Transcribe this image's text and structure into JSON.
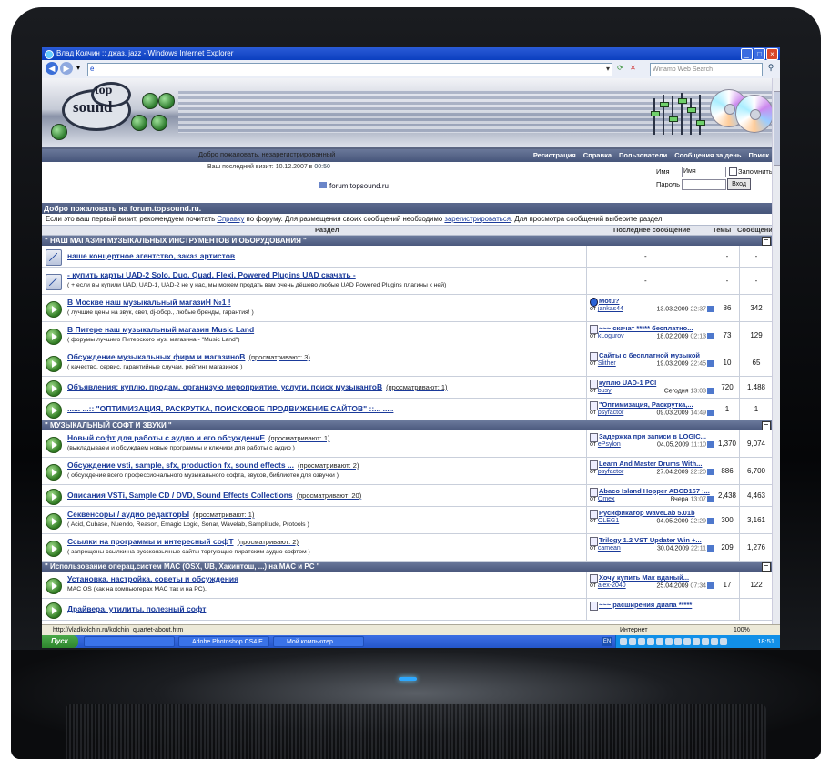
{
  "window": {
    "title": "Влад Колчин :: джаз, jazz - Windows Internet Explorer",
    "address": "e",
    "search_placeholder": "Winamp Web Search"
  },
  "logo": {
    "top": "top",
    "sound": "sound"
  },
  "header": {
    "welcome": "Добро пожаловать, незарегистрированный",
    "last_visit_label": "Ваш последний визит: 10.12.2007 в",
    "last_visit_time": "00:50",
    "forum_name": "forum.topsound.ru",
    "nav": [
      "Регистрация",
      "Справка",
      "Пользователи",
      "Сообщения за день",
      "Поиск"
    ]
  },
  "login": {
    "name_label": "Имя",
    "name_value": "Имя",
    "remember_label": "Запомнить?",
    "password_label": "Пароль",
    "submit": "Вход"
  },
  "welcome_bar": "Добро пожаловать на forum.topsound.ru.",
  "intro": {
    "part1": "Если это ваш первый визит, рекомендуем почитать ",
    "link1": "Справку",
    "part2": " по форуму. Для размещения своих сообщений необходимо ",
    "link2": "зарегистрироваться",
    "part3": ". Для просмотра сообщений выберите раздел."
  },
  "table_head": {
    "section": "Раздел",
    "last_post": "Последнее сообщение",
    "topics": "Темы",
    "posts": "Сообщения"
  },
  "categories": [
    {
      "title": "\" НАШ МАГАЗИН МУЗЫКАЛЬНЫХ ИНСТРУМЕНТОВ И ОБОРУДОВАНИЯ \"",
      "forums": [
        {
          "kind": "link",
          "title": "наше концертное агентство, заказ артистов",
          "viewing": "",
          "desc": "",
          "last_title": "",
          "by": "",
          "date": "",
          "time": "",
          "topics": "-",
          "posts": "-",
          "lp_dash": "-"
        },
        {
          "kind": "link",
          "title": "- купить карты UAD-2 Solo, Duo, Quad, Flexi, Powered Plugins UAD скачать -",
          "viewing": "",
          "desc": "( + если вы купили UAD, UAD-1, UAD-2 не у нас, мы можем продать вам очень дёшево любые UAD Powered Plugins плагины к ней)",
          "last_title": "",
          "by": "",
          "date": "",
          "time": "",
          "topics": "-",
          "posts": "-",
          "lp_dash": "-"
        },
        {
          "kind": "forum",
          "title": "В Москве наш музыкальный магазиН №1 !",
          "viewing": "",
          "desc": "( лучшие цены на звук, свет, dj-обор., любые бренды, гарантия! )",
          "last_title": "Мotu?",
          "by": "jankas44",
          "date": "13.03.2009",
          "time": "22:37",
          "topics": "86",
          "posts": "342",
          "lp_dash": "",
          "qicon": true
        },
        {
          "kind": "forum",
          "title": "В Питере наш музыкальный магазин Music Land",
          "viewing": "",
          "desc": "( форумы лучшего Питерского муз. магазина - \"Music Land\")",
          "last_title": "~~~ скачат ***** бесплатно...",
          "by": "kLogurov",
          "date": "18.02.2009",
          "time": "02:13",
          "topics": "73",
          "posts": "129",
          "lp_dash": ""
        },
        {
          "kind": "forum",
          "title": "Обсуждение музыкальных фирм и магазиноВ",
          "viewing": "(просматривают: 3)",
          "desc": "( качество, сервис, гарантийные случаи, рейтинг магазинов )",
          "last_title": "Сайты с бесплатной музыкой",
          "by": "Slither",
          "date": "19.03.2009",
          "time": "22:45",
          "topics": "10",
          "posts": "65",
          "lp_dash": ""
        },
        {
          "kind": "forum",
          "title": "Объявления: куплю, продам, организую мероприятие, услуги, поиск музыкантоВ",
          "viewing": "(просматривают: 1)",
          "desc": "",
          "last_title": "куплю UAD-1 PCI",
          "by": "busy",
          "date": "Сегодня",
          "time": "13:03",
          "topics": "720",
          "posts": "1,488",
          "lp_dash": ""
        },
        {
          "kind": "forum",
          "title": "...... ...:: \"ОПТИМИЗАЦИЯ, РАСКРУТКА, ПОИСКОВОЕ ПРОДВИЖЕНИЕ САЙТОВ\" ::... .....",
          "viewing": "",
          "desc": "",
          "last_title": "\"Оптимизация, Раскрутка,...",
          "by": "psyfactor",
          "date": "09.03.2009",
          "time": "14:49",
          "topics": "1",
          "posts": "1",
          "lp_dash": ""
        }
      ]
    },
    {
      "title": "\" МУЗЫКАЛЬНЫЙ СОФТ И ЗВУКИ \"",
      "forums": [
        {
          "kind": "forum",
          "title": "Новый софт для работы с аудио и его обсуждениЕ",
          "viewing": "(просматривают: 1)",
          "desc": "(выкладываем и обсуждаем новые программы и ключики для работы с аудио )",
          "last_title": "Задержка при записи в LOGIC...",
          "by": "ePsylon",
          "date": "04.05.2009",
          "time": "11:10",
          "topics": "1,370",
          "posts": "9,074",
          "lp_dash": ""
        },
        {
          "kind": "forum",
          "title": "Обсуждение vsti, sample, sfx, production fx, sound effects ...",
          "viewing": "(просматривают: 2)",
          "desc": "( обсуждение всего профессионального музыкального софта, звуков, библиотек для озвучки )",
          "last_title": "Learn And Master Drums With...",
          "by": "psyfactor",
          "date": "27.04.2009",
          "time": "22:20",
          "topics": "886",
          "posts": "6,700",
          "lp_dash": ""
        },
        {
          "kind": "forum",
          "title": "Описания VSTi, Sample CD / DVD, Sound Effects Collections",
          "viewing": "(просматривают: 20)",
          "desc": "",
          "last_title": "Abaco Island Hopper ABCD167 :...",
          "by": "Omex",
          "date": "Вчера",
          "time": "13:07",
          "topics": "2,438",
          "posts": "4,463",
          "lp_dash": ""
        },
        {
          "kind": "forum",
          "title": "Секвенсоры / аудио редакторЫ",
          "viewing": "(просматривают: 1)",
          "desc": "( Acid, Cubase, Nuendo, Reason, Emagic Logic, Sonar, Wavelab, Samplitude, Protools )",
          "last_title": "Русификатор WaveLab 5.01b",
          "by": "OLEG1",
          "date": "04.05.2009",
          "time": "22:29",
          "topics": "300",
          "posts": "3,161",
          "lp_dash": ""
        },
        {
          "kind": "forum",
          "title": "Ссылки на программы и интересный софТ",
          "viewing": "(просматривают: 2)",
          "desc": "( запрещены ссылки на русскоязычные сайты торгующие пиратским аудио софтом )",
          "last_title": "Trilogy 1.2 VST Updater Win +...",
          "by": "camean",
          "date": "30.04.2009",
          "time": "22:11",
          "topics": "209",
          "posts": "1,276",
          "lp_dash": ""
        }
      ]
    },
    {
      "title": "\" Использование операц.систем MAC (OSX, UB, Хакинтош, ...) на MAC и PC \"",
      "forums": [
        {
          "kind": "forum",
          "title": "Установка, настройка, советы и обсуждения",
          "viewing": "",
          "desc": "MAC OS (как на компьютерах MAC так и на PC).",
          "last_title": "Хочу купить Мак вданый...",
          "by": "alex-2040",
          "date": "25.04.2009",
          "time": "07:34",
          "topics": "17",
          "posts": "122",
          "lp_dash": ""
        },
        {
          "kind": "forum",
          "title": "Драйвера, утилиты, полезный софт",
          "viewing": "",
          "desc": "",
          "last_title": "~~~ расширения диапа *****",
          "by": "",
          "date": "",
          "time": "",
          "topics": "",
          "posts": "",
          "lp_dash": ""
        }
      ]
    }
  ],
  "status": {
    "url": "http://vladkolchin.ru/kolchin_quartet-about.htm",
    "zone": "Интернет",
    "zoom": "100%"
  },
  "taskbar": {
    "start": "Пуск",
    "items": [
      "",
      "Adobe Photoshop CS4 E...",
      "Мой компьютер"
    ],
    "lang": "EN",
    "clock": "18:51"
  }
}
